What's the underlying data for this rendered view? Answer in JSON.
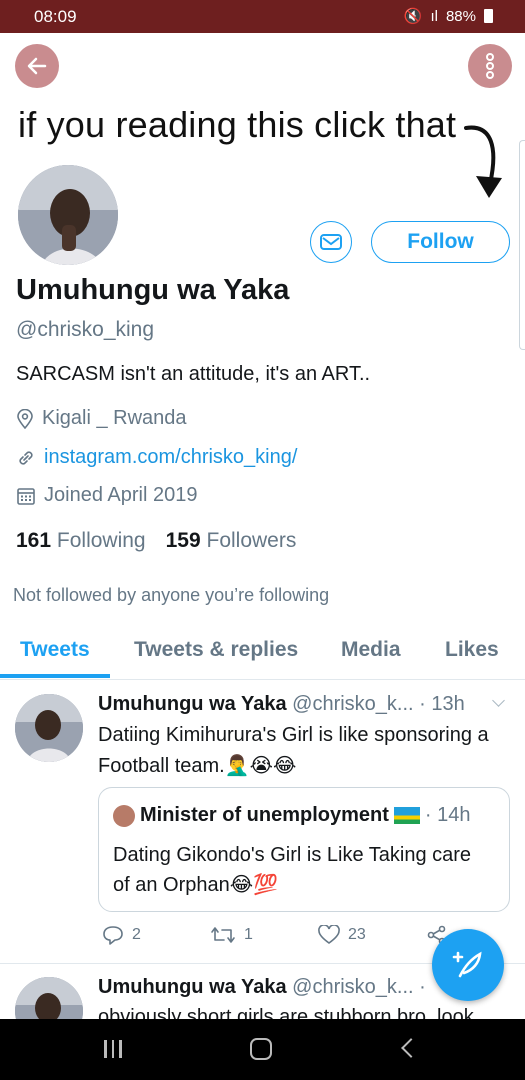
{
  "status_bar": {
    "time": "08:09",
    "signal": "ıl",
    "battery": "88%"
  },
  "header": {
    "back_icon": "arrow-left-icon",
    "more_icon": "vertical-dots-icon"
  },
  "overlay_text": "if you reading this click that",
  "profile": {
    "display_name": "Umuhungu wa Yaka",
    "handle": "@chrisko_king",
    "bio": "SARCASM isn't an attitude, it's an ART..",
    "location": "Kigali _ Rwanda",
    "website": "instagram.com/chrisko_king/",
    "joined": "Joined April 2019",
    "following_count": "161",
    "following_label": "Following",
    "followers_count": "159",
    "followers_label": "Followers",
    "follow_button": "Follow",
    "not_followed_text": "Not followed by anyone you’re following"
  },
  "tabs": [
    {
      "label": "Tweets",
      "active": true
    },
    {
      "label": "Tweets & replies"
    },
    {
      "label": "Media"
    },
    {
      "label": "Likes"
    }
  ],
  "tweets": [
    {
      "name": "Umuhungu wa Yaka",
      "handle": "@chrisko_k...",
      "time": "· 13h",
      "text": "Datiing Kimihurura's Girl is like sponsoring a Football team.🤦‍♂️😭😂",
      "quote": {
        "name": "Minister of unemployment",
        "time": "· 14h",
        "text": "Dating Gikondo's Girl is Like Taking care of an Orphan😂💯"
      },
      "replies": "2",
      "retweets": "1",
      "likes": "23"
    },
    {
      "name": "Umuhungu wa Yaka",
      "handle": "@chrisko_k...",
      "time": "·",
      "text": "obviously short girls are stubborn bro. look"
    }
  ],
  "colors": {
    "accent": "#1da1f2",
    "status_bar": "#6e1f1f",
    "header_button": "#c98c8f"
  }
}
